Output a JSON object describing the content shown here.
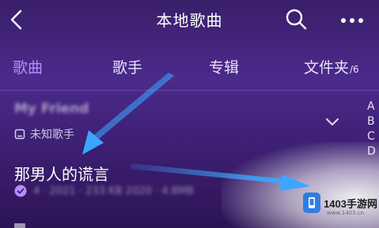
{
  "header": {
    "title": "本地歌曲"
  },
  "tabs": [
    {
      "label": "歌曲",
      "active": true
    },
    {
      "label": "歌手",
      "active": false
    },
    {
      "label": "专辑",
      "active": false
    },
    {
      "label": "文件夹",
      "count": "/6",
      "active": false
    }
  ],
  "group": {
    "title": "My Friend",
    "artist": "未知歌手"
  },
  "song": {
    "title": "那男人的谎言",
    "meta": "4 · 2021 · 233 KB 2020 · 4.8MB"
  },
  "alphabet_index": [
    "A",
    "B",
    "C",
    "D"
  ],
  "watermark": {
    "brand": "1403手游网",
    "url": "www.1403.cn"
  },
  "colors": {
    "accent": "#b68cff",
    "arrow": "#3aa6ff",
    "background": "#3d2270"
  },
  "icons": {
    "back": "chevron-left-icon",
    "search": "search-icon",
    "more": "more-icon",
    "collapse": "chevron-down-icon",
    "downloaded": "check-circle-icon"
  }
}
